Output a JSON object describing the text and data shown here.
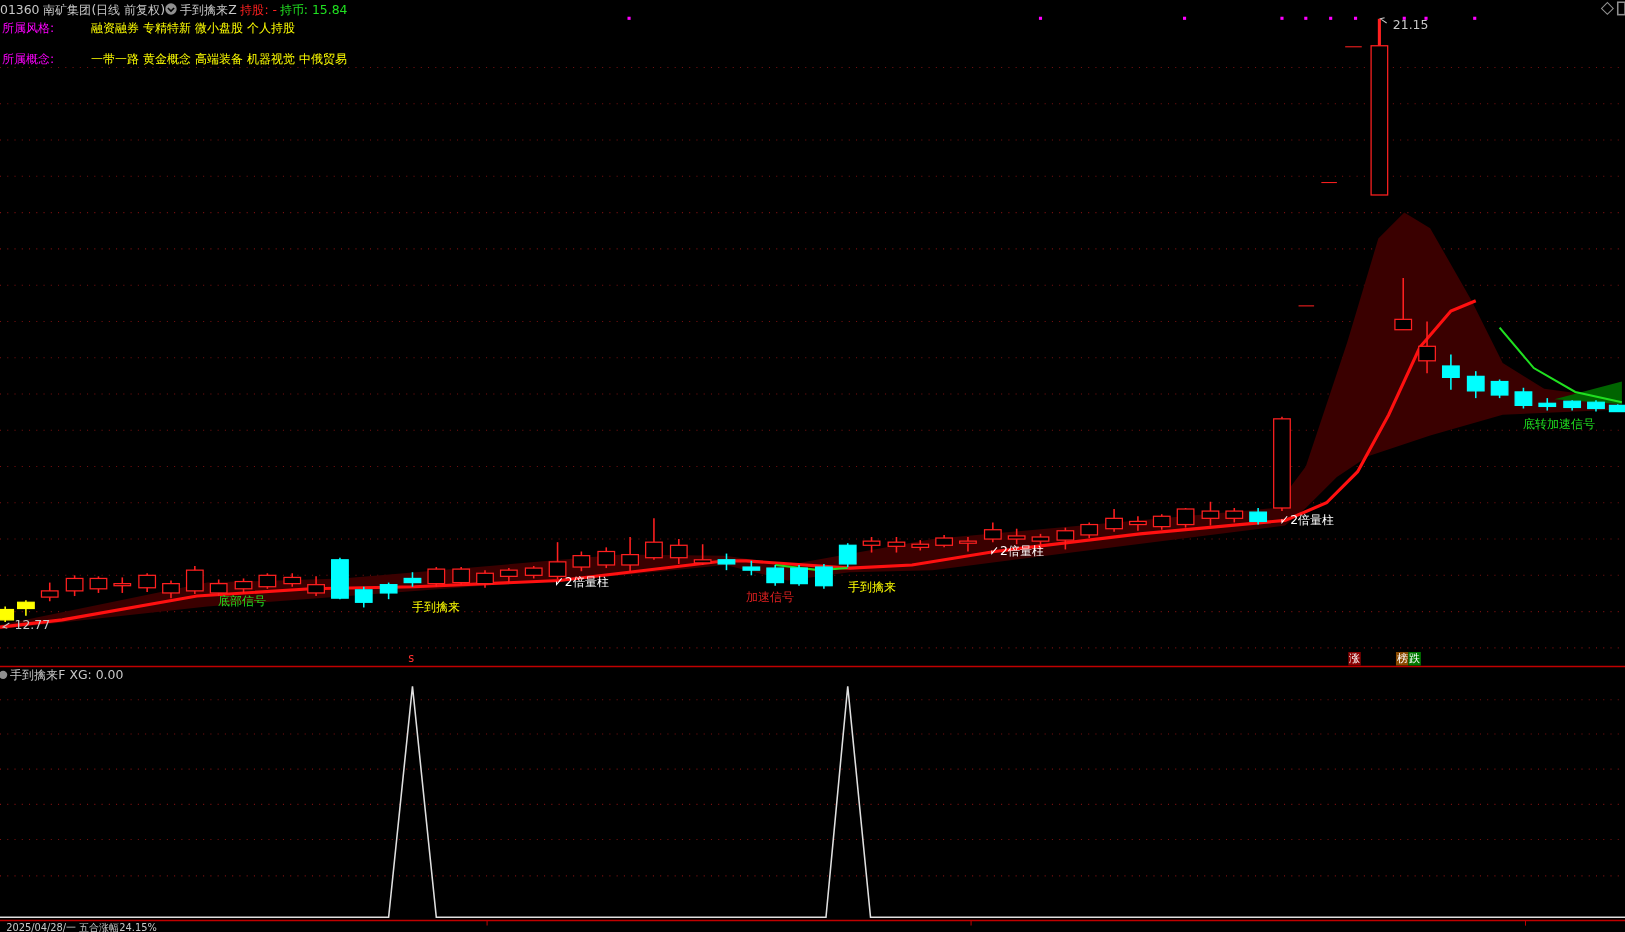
{
  "header": {
    "stock": "01360 南矿集团(日线 前复权)",
    "indicator": "手到擒来Z",
    "holding": "持股: -",
    "cash": "持币: 15.84"
  },
  "info_rows": [
    {
      "label": "所属风格:",
      "value": "融资融券 专精特新 微小盘股 个人持股"
    },
    {
      "label": "所属概念:",
      "value": "一带一路 黄金概念 高端装备 机器视觉 中俄贸易"
    }
  ],
  "price_labels": {
    "high": "21.15",
    "low": "12.77"
  },
  "signals": [
    {
      "text": "底部信号",
      "kind": "bottom"
    },
    {
      "text": "手到擒来",
      "kind": "catch"
    },
    {
      "text": "2倍量柱",
      "kind": "volume"
    },
    {
      "text": "加速信号",
      "kind": "accel"
    },
    {
      "text": "手到擒来",
      "kind": "catch"
    },
    {
      "text": "2倍量柱",
      "kind": "volume"
    },
    {
      "text": "2倍量柱",
      "kind": "volume"
    },
    {
      "text": "底转加速信号",
      "kind": "bottom"
    }
  ],
  "markers": [
    {
      "text": "s",
      "kind": "tick"
    },
    {
      "text": "涨",
      "kind": "rise"
    },
    {
      "text": "榜",
      "kind": "list"
    },
    {
      "text": "跌",
      "kind": "fall"
    }
  ],
  "sub_panel": {
    "title": "手到擒来F",
    "reading": "XG: 0.00"
  },
  "axis": {
    "date": "2025/04/28/一 五合涨幅24.15%"
  }
}
